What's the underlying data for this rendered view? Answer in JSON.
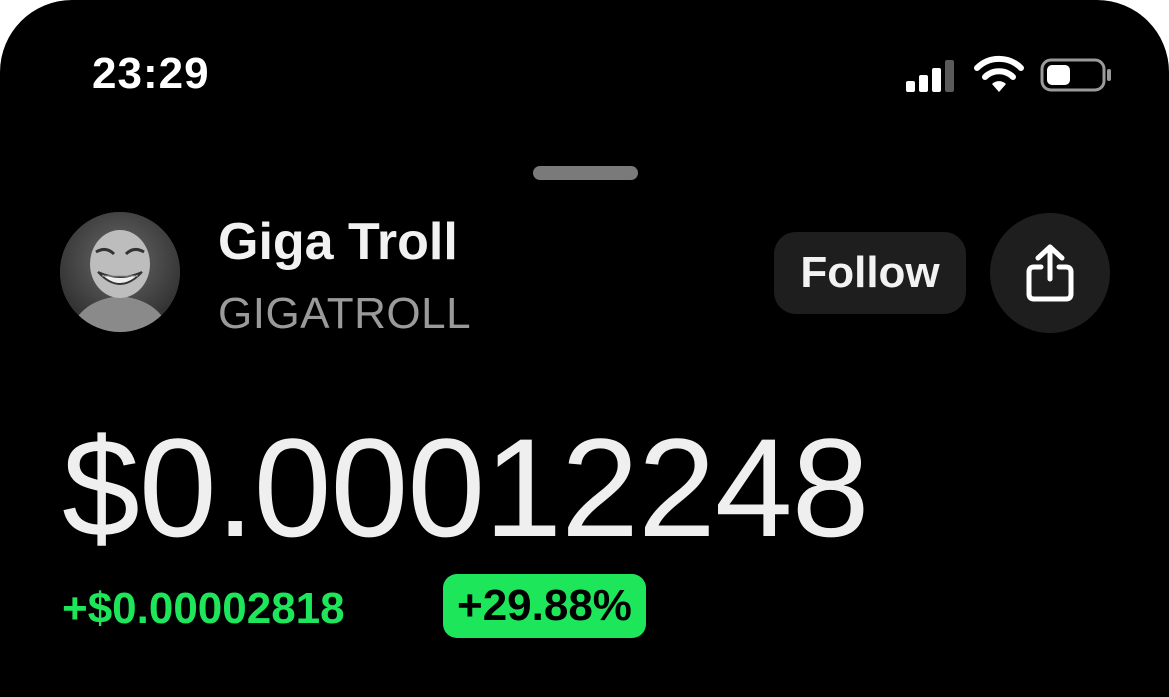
{
  "status_bar": {
    "time": "23:29",
    "icons": [
      "cellular-signal-icon",
      "wifi-icon",
      "battery-icon"
    ],
    "battery_level": 0.45
  },
  "token": {
    "name": "Giga Troll",
    "symbol": "GIGATROLL",
    "avatar_icon": "troll-face-avatar"
  },
  "actions": {
    "follow_label": "Follow",
    "share_icon": "share-icon"
  },
  "price": {
    "value": "$0.00012248",
    "change_abs": "+$0.00002818",
    "change_pct": "+29.88%"
  },
  "colors": {
    "background": "#000000",
    "positive": "#1ee65a",
    "button_bg": "#1e1e1e",
    "secondary_text": "#9a9a9a"
  }
}
